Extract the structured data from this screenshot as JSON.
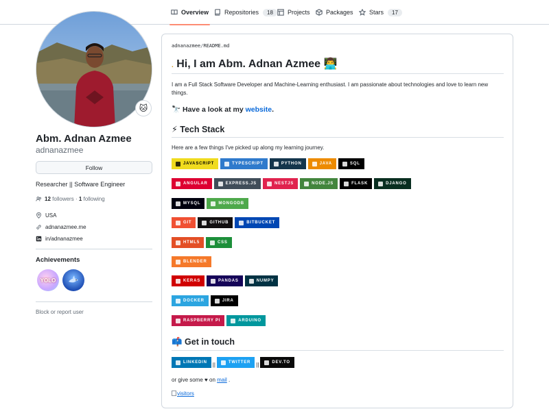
{
  "tabs": [
    {
      "label": "Overview",
      "icon": "book-icon",
      "active": true
    },
    {
      "label": "Repositories",
      "icon": "repo-icon",
      "count": "18"
    },
    {
      "label": "Projects",
      "icon": "table-icon"
    },
    {
      "label": "Packages",
      "icon": "package-icon"
    },
    {
      "label": "Stars",
      "icon": "star-icon",
      "count": "17"
    }
  ],
  "profile": {
    "status_emoji": "🐱",
    "name": "Abm. Adnan Azmee",
    "login": "adnanazmee",
    "follow_label": "Follow",
    "bio": "Researcher || Software Engineer",
    "followers_count": "12",
    "followers_label": "followers",
    "following_count": "1",
    "following_label": "following",
    "location": "USA",
    "website": "adnanazmee.me",
    "linkedin": "in/adnanazmee",
    "achievements_title": "Achievements",
    "block_label": "Block or report user"
  },
  "readme": {
    "path_user": "adnanazmee",
    "path_sep": "/",
    "path_file": "README.md",
    "title_dot": ".",
    "title": "Hi, I am Abm. Adnan Azmee 👨‍💻",
    "intro": "I am a Full Stack Software Developer and Machine-Learning enthusiast. I am passionate about technologies and love to learn new things.",
    "look_prefix": "🔭 Have a look at my ",
    "look_link": "website",
    "look_suffix": ".",
    "tech_title": "⚡ Tech Stack",
    "tech_intro": "Here are a few things I've picked up along my learning journey.",
    "contact_title": "📫 Get in touch",
    "contact_sep": "||",
    "mail_prefix": "or give some ♥ on ",
    "mail_link": "mail",
    "mail_suffix": " .",
    "visitors": "visitors"
  },
  "badge_rows": [
    [
      {
        "label": "JAVASCRIPT",
        "bg": "#f0db1e",
        "fg": "#000000"
      },
      {
        "label": "TYPESCRIPT",
        "bg": "#2f7acc",
        "fg": "#ffffff"
      },
      {
        "label": "PYTHON",
        "bg": "#14354c",
        "fg": "#ffffff"
      },
      {
        "label": "JAVA",
        "bg": "#ed8b00",
        "fg": "#ffffff"
      },
      {
        "label": "SQL",
        "bg": "#000000",
        "fg": "#ffffff"
      }
    ],
    [
      {
        "label": "ANGULAR",
        "bg": "#dd0031",
        "fg": "#ffffff"
      },
      {
        "label": "EXPRESS.JS",
        "bg": "#404d59",
        "fg": "#ffffff"
      },
      {
        "label": "NESTJS",
        "bg": "#e0234e",
        "fg": "#ffffff"
      },
      {
        "label": "NODE.JS",
        "bg": "#43853d",
        "fg": "#ffffff"
      },
      {
        "label": "FLASK",
        "bg": "#000000",
        "fg": "#ffffff"
      },
      {
        "label": "DJANGO",
        "bg": "#092e20",
        "fg": "#ffffff"
      }
    ],
    [
      {
        "label": "MYSQL",
        "bg": "#00000f",
        "fg": "#ffffff"
      },
      {
        "label": "MONGODB",
        "bg": "#4ea94b",
        "fg": "#ffffff"
      }
    ],
    [
      {
        "label": "GIT",
        "bg": "#f05033",
        "fg": "#ffffff"
      },
      {
        "label": "GITHUB",
        "bg": "#121011",
        "fg": "#ffffff"
      },
      {
        "label": "BITBUCKET",
        "bg": "#0047b3",
        "fg": "#ffffff"
      }
    ],
    [
      {
        "label": "HTML5",
        "bg": "#e34f26",
        "fg": "#ffffff"
      },
      {
        "label": "CSS",
        "bg": "#1d8f3a",
        "fg": "#ffffff"
      }
    ],
    [
      {
        "label": "BLENDER",
        "bg": "#f5792a",
        "fg": "#ffffff"
      }
    ],
    [
      {
        "label": "KERAS",
        "bg": "#d00000",
        "fg": "#ffffff"
      },
      {
        "label": "PANDAS",
        "bg": "#150458",
        "fg": "#ffffff"
      },
      {
        "label": "NUMPY",
        "bg": "#013243",
        "fg": "#ffffff"
      }
    ],
    [
      {
        "label": "DOCKER",
        "bg": "#2ca5e0",
        "fg": "#ffffff"
      },
      {
        "label": "JIRA",
        "bg": "#000000",
        "fg": "#ffffff"
      }
    ],
    [
      {
        "label": "RASPBERRY PI",
        "bg": "#c51a4a",
        "fg": "#ffffff"
      },
      {
        "label": "ARDUINO",
        "bg": "#00979d",
        "fg": "#ffffff"
      }
    ]
  ],
  "contact_badges": [
    {
      "label": "LINKEDIN",
      "bg": "#0077b5",
      "fg": "#ffffff"
    },
    {
      "label": "TWITTER",
      "bg": "#1da1f2",
      "fg": "#ffffff"
    },
    {
      "label": "DEV.TO",
      "bg": "#0a0a0a",
      "fg": "#ffffff"
    }
  ]
}
